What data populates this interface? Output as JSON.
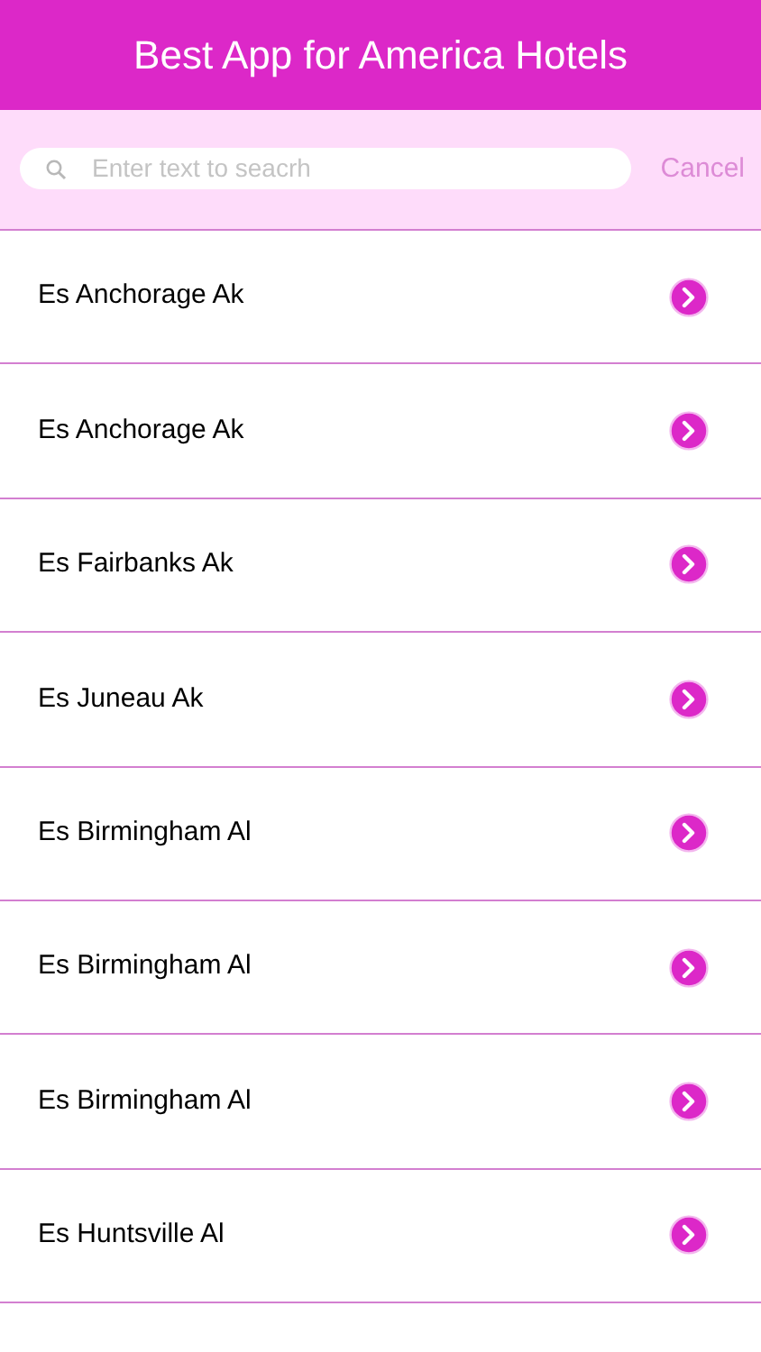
{
  "header": {
    "title": "Best App for America Hotels"
  },
  "search": {
    "placeholder": "Enter text to seacrh",
    "cancel": "Cancel"
  },
  "rows": [
    {
      "label": "Es Anchorage Ak"
    },
    {
      "label": "Es Anchorage Ak"
    },
    {
      "label": "Es Fairbanks Ak"
    },
    {
      "label": "Es Juneau Ak"
    },
    {
      "label": "Es Birmingham Al"
    },
    {
      "label": "Es Birmingham Al"
    },
    {
      "label": "Es Birmingham Al"
    },
    {
      "label": "Es Huntsville Al"
    }
  ]
}
